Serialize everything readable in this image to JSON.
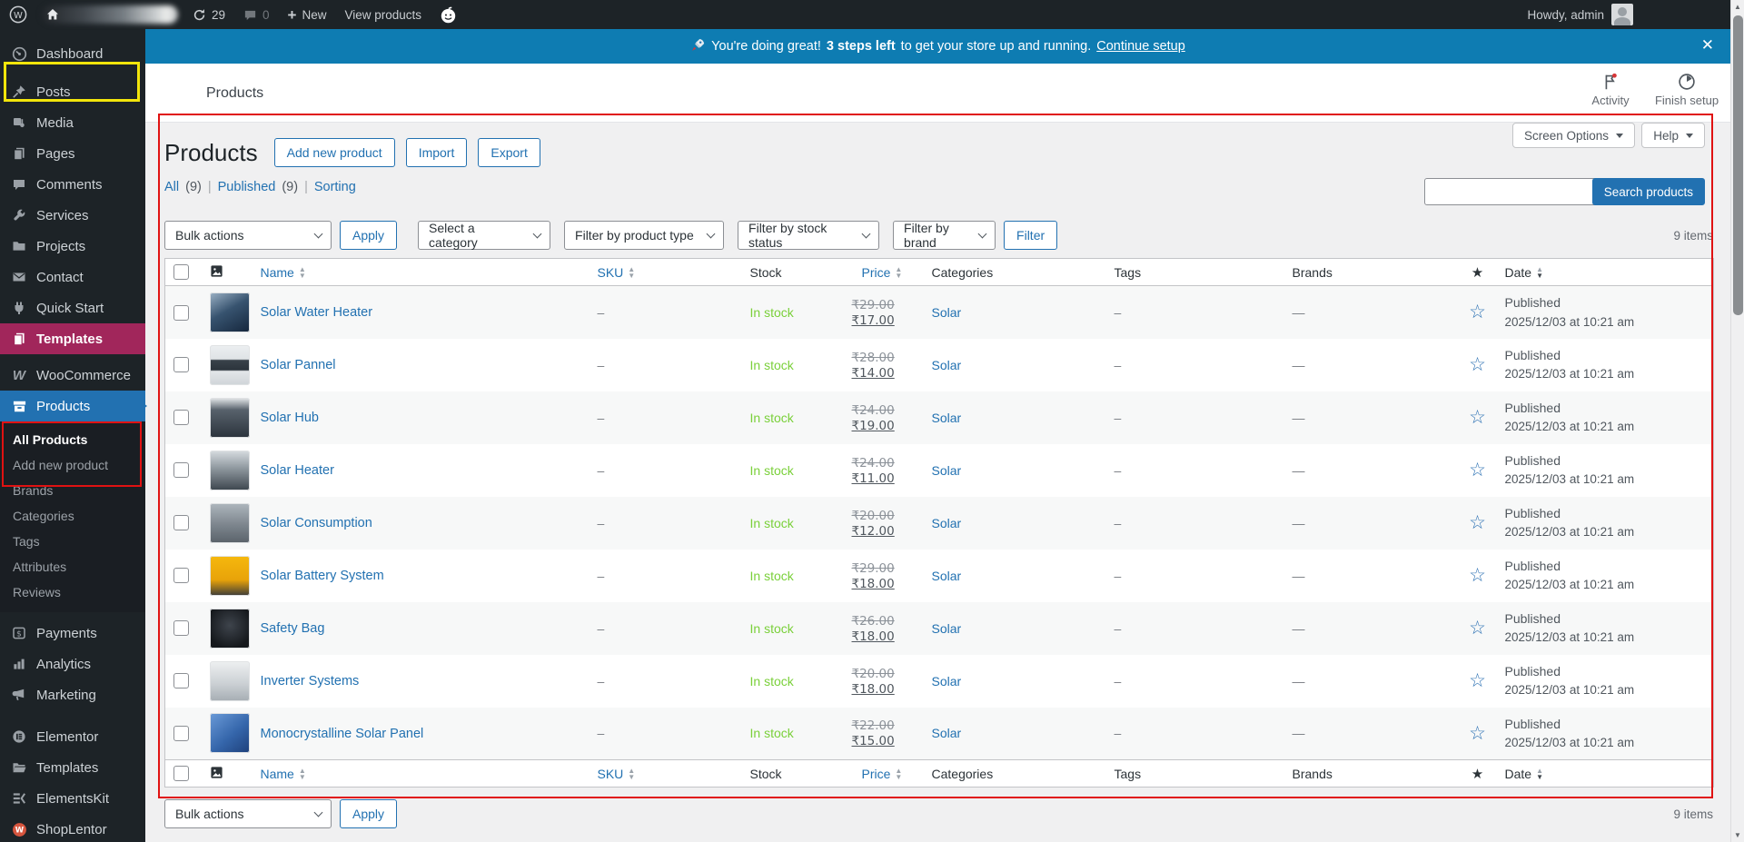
{
  "admin_bar": {
    "updates_count": "29",
    "comments_count": "0",
    "new_label": "New",
    "view_products_label": "View products",
    "howdy": "Howdy, admin"
  },
  "notice": {
    "message_intro": "You're doing great!",
    "steps_highlight": "3 steps left",
    "message_rest": "to get your store up and running.",
    "link_label": "Continue setup"
  },
  "page_header": {
    "breadcrumb": "Products",
    "activity_label": "Activity",
    "finish_setup_label": "Finish setup"
  },
  "sidebar": {
    "items": [
      {
        "label": "Dashboard"
      },
      {
        "label": "Posts"
      },
      {
        "label": "Media"
      },
      {
        "label": "Pages"
      },
      {
        "label": "Comments"
      },
      {
        "label": "Services"
      },
      {
        "label": "Projects"
      },
      {
        "label": "Contact"
      },
      {
        "label": "Quick Start"
      },
      {
        "label": "Templates"
      },
      {
        "label": "WooCommerce"
      },
      {
        "label": "Products"
      },
      {
        "label": "Payments"
      },
      {
        "label": "Analytics"
      },
      {
        "label": "Marketing"
      },
      {
        "label": "Elementor"
      },
      {
        "label": "Templates"
      },
      {
        "label": "ElementsKit"
      },
      {
        "label": "ShopLentor"
      }
    ],
    "products_submenu": [
      {
        "label": "All Products"
      },
      {
        "label": "Add new product"
      },
      {
        "label": "Brands"
      },
      {
        "label": "Categories"
      },
      {
        "label": "Tags"
      },
      {
        "label": "Attributes"
      },
      {
        "label": "Reviews"
      }
    ]
  },
  "toolbar": {
    "title": "Products",
    "add_new_label": "Add new product",
    "import_label": "Import",
    "export_label": "Export",
    "screen_options_label": "Screen Options",
    "help_label": "Help",
    "search_button_label": "Search products",
    "views": {
      "all": "All",
      "all_count": "(9)",
      "published": "Published",
      "published_count": "(9)",
      "sorting": "Sorting",
      "sep": "|"
    }
  },
  "filters": {
    "bulk_actions": "Bulk actions",
    "apply_label": "Apply",
    "category_placeholder": "Select a category",
    "product_type_placeholder": "Filter by product type",
    "stock_status_placeholder": "Filter by stock status",
    "brand_placeholder": "Filter by brand",
    "filter_label": "Filter",
    "items_count": "9 items"
  },
  "table": {
    "columns": {
      "name": "Name",
      "sku": "SKU",
      "stock": "Stock",
      "price": "Price",
      "categories": "Categories",
      "tags": "Tags",
      "brands": "Brands",
      "date": "Date"
    }
  },
  "products": [
    {
      "name": "Solar Water Heater",
      "sku": "–",
      "stock": "In stock",
      "price_old": "₹29.00",
      "price_new": "₹17.00",
      "category": "Solar",
      "tags": "–",
      "brands": "—",
      "status": "Published",
      "date": "2025/12/03 at 10:21 am",
      "thumb": "background:linear-gradient(150deg,#9db3c7 0%,#37536f 45%,#15263c 100%)"
    },
    {
      "name": "Solar Pannel",
      "sku": "–",
      "stock": "In stock",
      "price_old": "₹28.00",
      "price_new": "₹14.00",
      "category": "Solar",
      "tags": "–",
      "brands": "—",
      "status": "Published",
      "date": "2025/12/03 at 10:21 am",
      "thumb": "background:linear-gradient(180deg,#eceff1 0%,#dfe3e6 35%,#39424a 38%,#2c343c 62%,#e3e6e9 65%,#cfd4d8 100%)"
    },
    {
      "name": "Solar Hub",
      "sku": "–",
      "stock": "In stock",
      "price_old": "₹24.00",
      "price_new": "₹19.00",
      "category": "Solar",
      "tags": "–",
      "brands": "—",
      "status": "Published",
      "date": "2025/12/03 at 10:21 am",
      "thumb": "background:linear-gradient(180deg,#e7eaec 0%,#58626c 30%,#2b333c 100%)"
    },
    {
      "name": "Solar Heater",
      "sku": "–",
      "stock": "In stock",
      "price_old": "₹24.00",
      "price_new": "₹11.00",
      "category": "Solar",
      "tags": "–",
      "brands": "—",
      "status": "Published",
      "date": "2025/12/03 at 10:21 am",
      "thumb": "background:linear-gradient(180deg,#d7dce0 0%,#8e979e 45%,#3c454d 100%)"
    },
    {
      "name": "Solar Consumption",
      "sku": "–",
      "stock": "In stock",
      "price_old": "₹20.00",
      "price_new": "₹12.00",
      "category": "Solar",
      "tags": "–",
      "brands": "—",
      "status": "Published",
      "date": "2025/12/03 at 10:21 am",
      "thumb": "background:linear-gradient(180deg,#aeb6bd 0%,#7c858d 55%,#5a626a 100%)"
    },
    {
      "name": "Solar Battery System",
      "sku": "–",
      "stock": "In stock",
      "price_old": "₹29.00",
      "price_new": "₹18.00",
      "category": "Solar",
      "tags": "–",
      "brands": "—",
      "status": "Published",
      "date": "2025/12/03 at 10:21 am",
      "thumb": "background:linear-gradient(180deg,#f6b80d 0%,#e8a309 60%,#3a3a3a 100%)"
    },
    {
      "name": "Safety Bag",
      "sku": "–",
      "stock": "In stock",
      "price_old": "₹26.00",
      "price_new": "₹18.00",
      "category": "Solar",
      "tags": "–",
      "brands": "—",
      "status": "Published",
      "date": "2025/12/03 at 10:21 am",
      "thumb": "background:radial-gradient(circle at 50% 42%,#3e444c 0%,#15181c 75%)"
    },
    {
      "name": "Inverter Systems",
      "sku": "–",
      "stock": "In stock",
      "price_old": "₹20.00",
      "price_new": "₹18.00",
      "category": "Solar",
      "tags": "–",
      "brands": "—",
      "status": "Published",
      "date": "2025/12/03 at 10:21 am",
      "thumb": "background:linear-gradient(180deg,#eef0f1 0%,#ccd1d5 55%,#a6adb3 100%)"
    },
    {
      "name": "Monocrystalline Solar Panel",
      "sku": "–",
      "stock": "In stock",
      "price_old": "₹22.00",
      "price_new": "₹15.00",
      "category": "Solar",
      "tags": "–",
      "brands": "—",
      "status": "Published",
      "date": "2025/12/03 at 10:21 am",
      "thumb": "background:linear-gradient(140deg,#6b9bd8 0%,#3566ab 55%,#1e407a 100%)"
    }
  ],
  "colors": {
    "accent_blue": "#2271b1",
    "notice_blue": "#0e7cb2",
    "in_stock_green": "#7ad03a",
    "sidebar_active_pink": "#a1265b",
    "annotation_red": "#e01212",
    "annotation_yellow": "#f2e50b"
  }
}
